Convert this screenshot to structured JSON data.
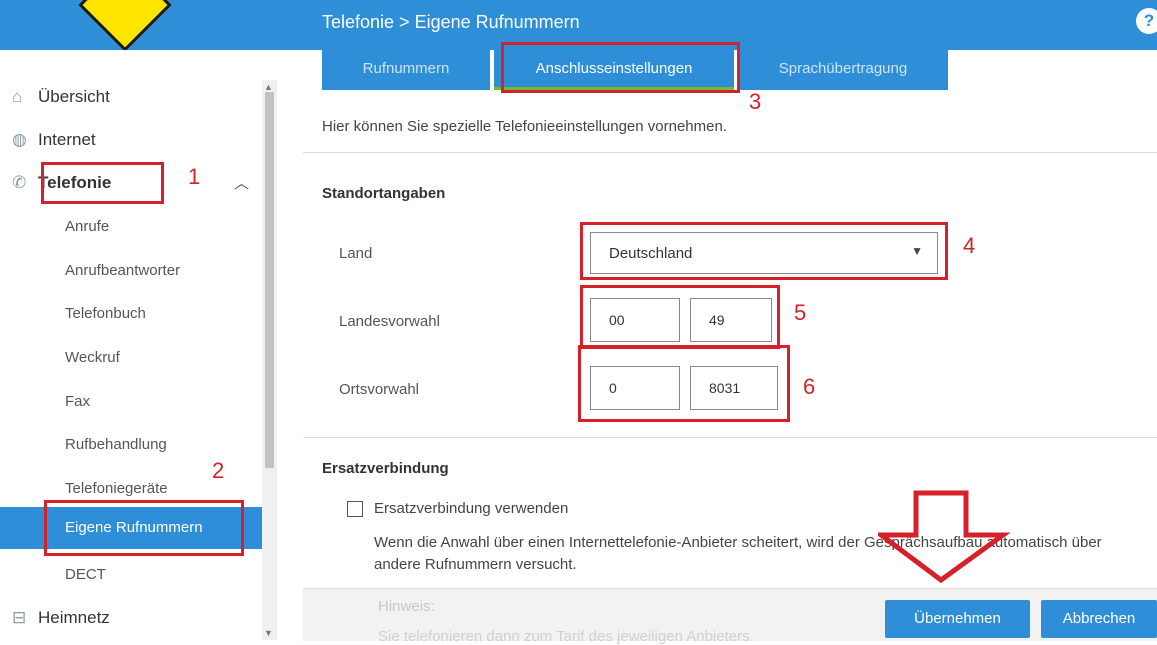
{
  "header": {
    "breadcrumb": "Telefonie > Eigene Rufnummern",
    "help_icon": "?"
  },
  "tabs": [
    {
      "label": "Rufnummern"
    },
    {
      "label": "Anschlusseinstellungen"
    },
    {
      "label": "Sprachübertragung"
    }
  ],
  "sidebar": {
    "top_items": [
      {
        "label": "Übersicht",
        "icon": "home-icon"
      },
      {
        "label": "Internet",
        "icon": "globe-icon"
      },
      {
        "label": "Telefonie",
        "icon": "phone-icon"
      }
    ],
    "sub_items": [
      {
        "label": "Anrufe"
      },
      {
        "label": "Anrufbeantworter"
      },
      {
        "label": "Telefonbuch"
      },
      {
        "label": "Weckruf"
      },
      {
        "label": "Fax"
      },
      {
        "label": "Rufbehandlung"
      },
      {
        "label": "Telefoniegeräte"
      },
      {
        "label": "Eigene Rufnummern"
      },
      {
        "label": "DECT"
      }
    ],
    "bottom_item": {
      "label": "Heimnetz",
      "icon": "network-icon"
    }
  },
  "main": {
    "intro": "Hier können Sie spezielle Telefonieeinstellungen vornehmen.",
    "standort": {
      "title": "Standortangaben",
      "land_label": "Land",
      "land_value": "Deutschland",
      "landesvorwahl_label": "Landesvorwahl",
      "landesvorwahl_prefix": "00",
      "landesvorwahl_code": "49",
      "ortsvorwahl_label": "Ortsvorwahl",
      "ortsvorwahl_prefix": "0",
      "ortsvorwahl_code": "8031"
    },
    "ersatz": {
      "title": "Ersatzverbindung",
      "checkbox_label": "Ersatzverbindung verwenden",
      "description": "Wenn die Anwahl über einen Internettelefonie-Anbieter scheitert, wird der Gesprächsaufbau automatisch über andere Rufnummern versucht."
    }
  },
  "footer": {
    "hinweis": "Hinweis:",
    "hinweis_text": "Sie telefonieren dann zum Tarif des jeweiligen Anbieters.",
    "apply_label": "Übernehmen",
    "cancel_label": "Abbrechen"
  },
  "annotations": [
    "1",
    "2",
    "3",
    "4",
    "5",
    "6"
  ],
  "colors": {
    "accent": "#2e8fd8",
    "annotation": "#d6202a",
    "tab_underline": "#79b829"
  }
}
